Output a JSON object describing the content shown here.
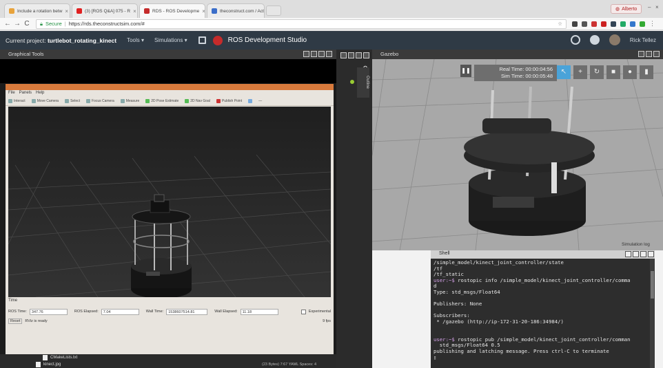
{
  "browser": {
    "tabs": [
      {
        "title": "Include a rotation betw",
        "color": "#e8a33c",
        "active": false
      },
      {
        "title": "(3) [ROS Q&A] 075 - R",
        "color": "#e02020",
        "active": false
      },
      {
        "title": "RDS - ROS Developme",
        "color": "#c52b2b",
        "active": true
      },
      {
        "title": "theconstruct.com / Act",
        "color": "#3b6ec9",
        "active": false
      }
    ],
    "profile": "Alberto",
    "secure_label": "Secure",
    "url": "https://rds.theconstructsim.com/#"
  },
  "app": {
    "project_prefix": "Current project:",
    "project_name": "turtlebot_rotating_kinect",
    "menu_tools": "Tools ▾",
    "menu_simulations": "Simulations ▾",
    "brand": "ROS Development Studio",
    "username": "Rick Tellez"
  },
  "graphical_tools": {
    "title": "Graphical Tools",
    "rviz_menu": [
      "File",
      "Panels",
      "Help"
    ],
    "rviz_tools": [
      "Interact",
      "Move Camera",
      "Select",
      "Focus Camera",
      "Measure",
      "2D Pose Estimate",
      "2D Nav Goal",
      "Publish Point"
    ],
    "time_label": "Time",
    "ros_time_label": "ROS Time:",
    "ros_time": "347.76",
    "ros_elapsed_label": "ROS Elapsed:",
    "ros_elapsed": "7.04",
    "wall_time_label": "Wall Time:",
    "wall_time": "1538607514.81",
    "wall_elapsed_label": "Wall Elapsed:",
    "wall_elapsed": "11.18",
    "experimental_label": "Experimental",
    "reset_label": "Reset",
    "status": "RViz is ready",
    "fps": "9 fps",
    "files": [
      "CMakeLists.txt",
      "kinect.jpg"
    ],
    "bottom_status": "(23 Bytes)   7:67   YAML   Spaces: 4"
  },
  "outline_label": "Outline",
  "gazebo": {
    "title": "Gazebo",
    "real_time": "Real Time: 00:00:04:56",
    "sim_time": "Sim Time: 00:00:05:48",
    "sim_log": "Simulation log"
  },
  "shell": {
    "title": "Shell",
    "lines": [
      {
        "u": "",
        "t": "/simple_model/kinect_joint_controller/state"
      },
      {
        "u": "",
        "t": "/tf"
      },
      {
        "u": "",
        "t": "/tf_static"
      },
      {
        "u": "user:~$ ",
        "t": "rostopic info /simple_model/kinect_joint_controller/comma"
      },
      {
        "u": "",
        "t": "d"
      },
      {
        "u": "",
        "t": "Type: std_msgs/Float64"
      },
      {
        "u": "",
        "t": ""
      },
      {
        "u": "",
        "t": "Publishers: None"
      },
      {
        "u": "",
        "t": ""
      },
      {
        "u": "",
        "t": "Subscribers:"
      },
      {
        "u": "",
        "t": " * /gazebo (http://ip-172-31-20-186:34984/)"
      },
      {
        "u": "",
        "t": ""
      },
      {
        "u": "",
        "t": ""
      },
      {
        "u": "user:~$ ",
        "t": "rostopic pub /simple_model/kinect_joint_controller/comman"
      },
      {
        "u": "",
        "t": "  std_msgs/Float64 0.5"
      },
      {
        "u": "",
        "t": "publishing and latching message. Press ctrl-C to terminate"
      },
      {
        "u": "",
        "t": "▯"
      }
    ]
  }
}
